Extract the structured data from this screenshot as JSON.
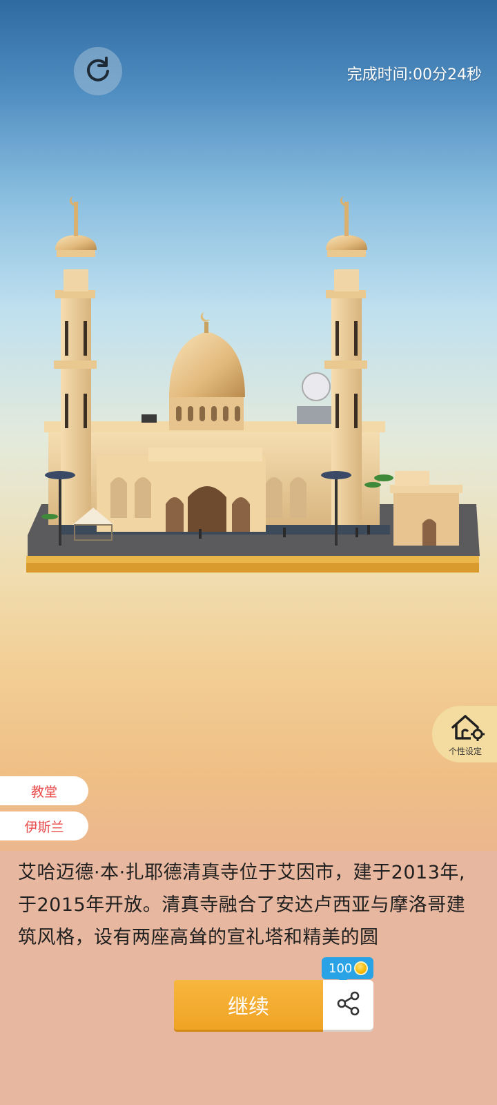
{
  "header": {
    "restart_icon": "restart-icon",
    "timer_text": "完成时间:00分24秒"
  },
  "settings": {
    "icon": "house-gear-icon",
    "label": "个性设定"
  },
  "tags": [
    {
      "label": "教堂"
    },
    {
      "label": "伊斯兰"
    }
  ],
  "description": {
    "text": "艾哈迈德·本·扎耶德清真寺位于艾因市，建于2013年,于2015年开放。清真寺融合了安达卢西亚与摩洛哥建筑风格，设有两座高耸的宣礼塔和精美的圆"
  },
  "actions": {
    "continue_label": "继续",
    "share_icon": "share-icon",
    "coin_amount": "100",
    "coin_icon": "coin-icon"
  },
  "colors": {
    "accent": "#f0a324",
    "badge": "#2aa3e6",
    "tag_text": "#e84a4a"
  }
}
